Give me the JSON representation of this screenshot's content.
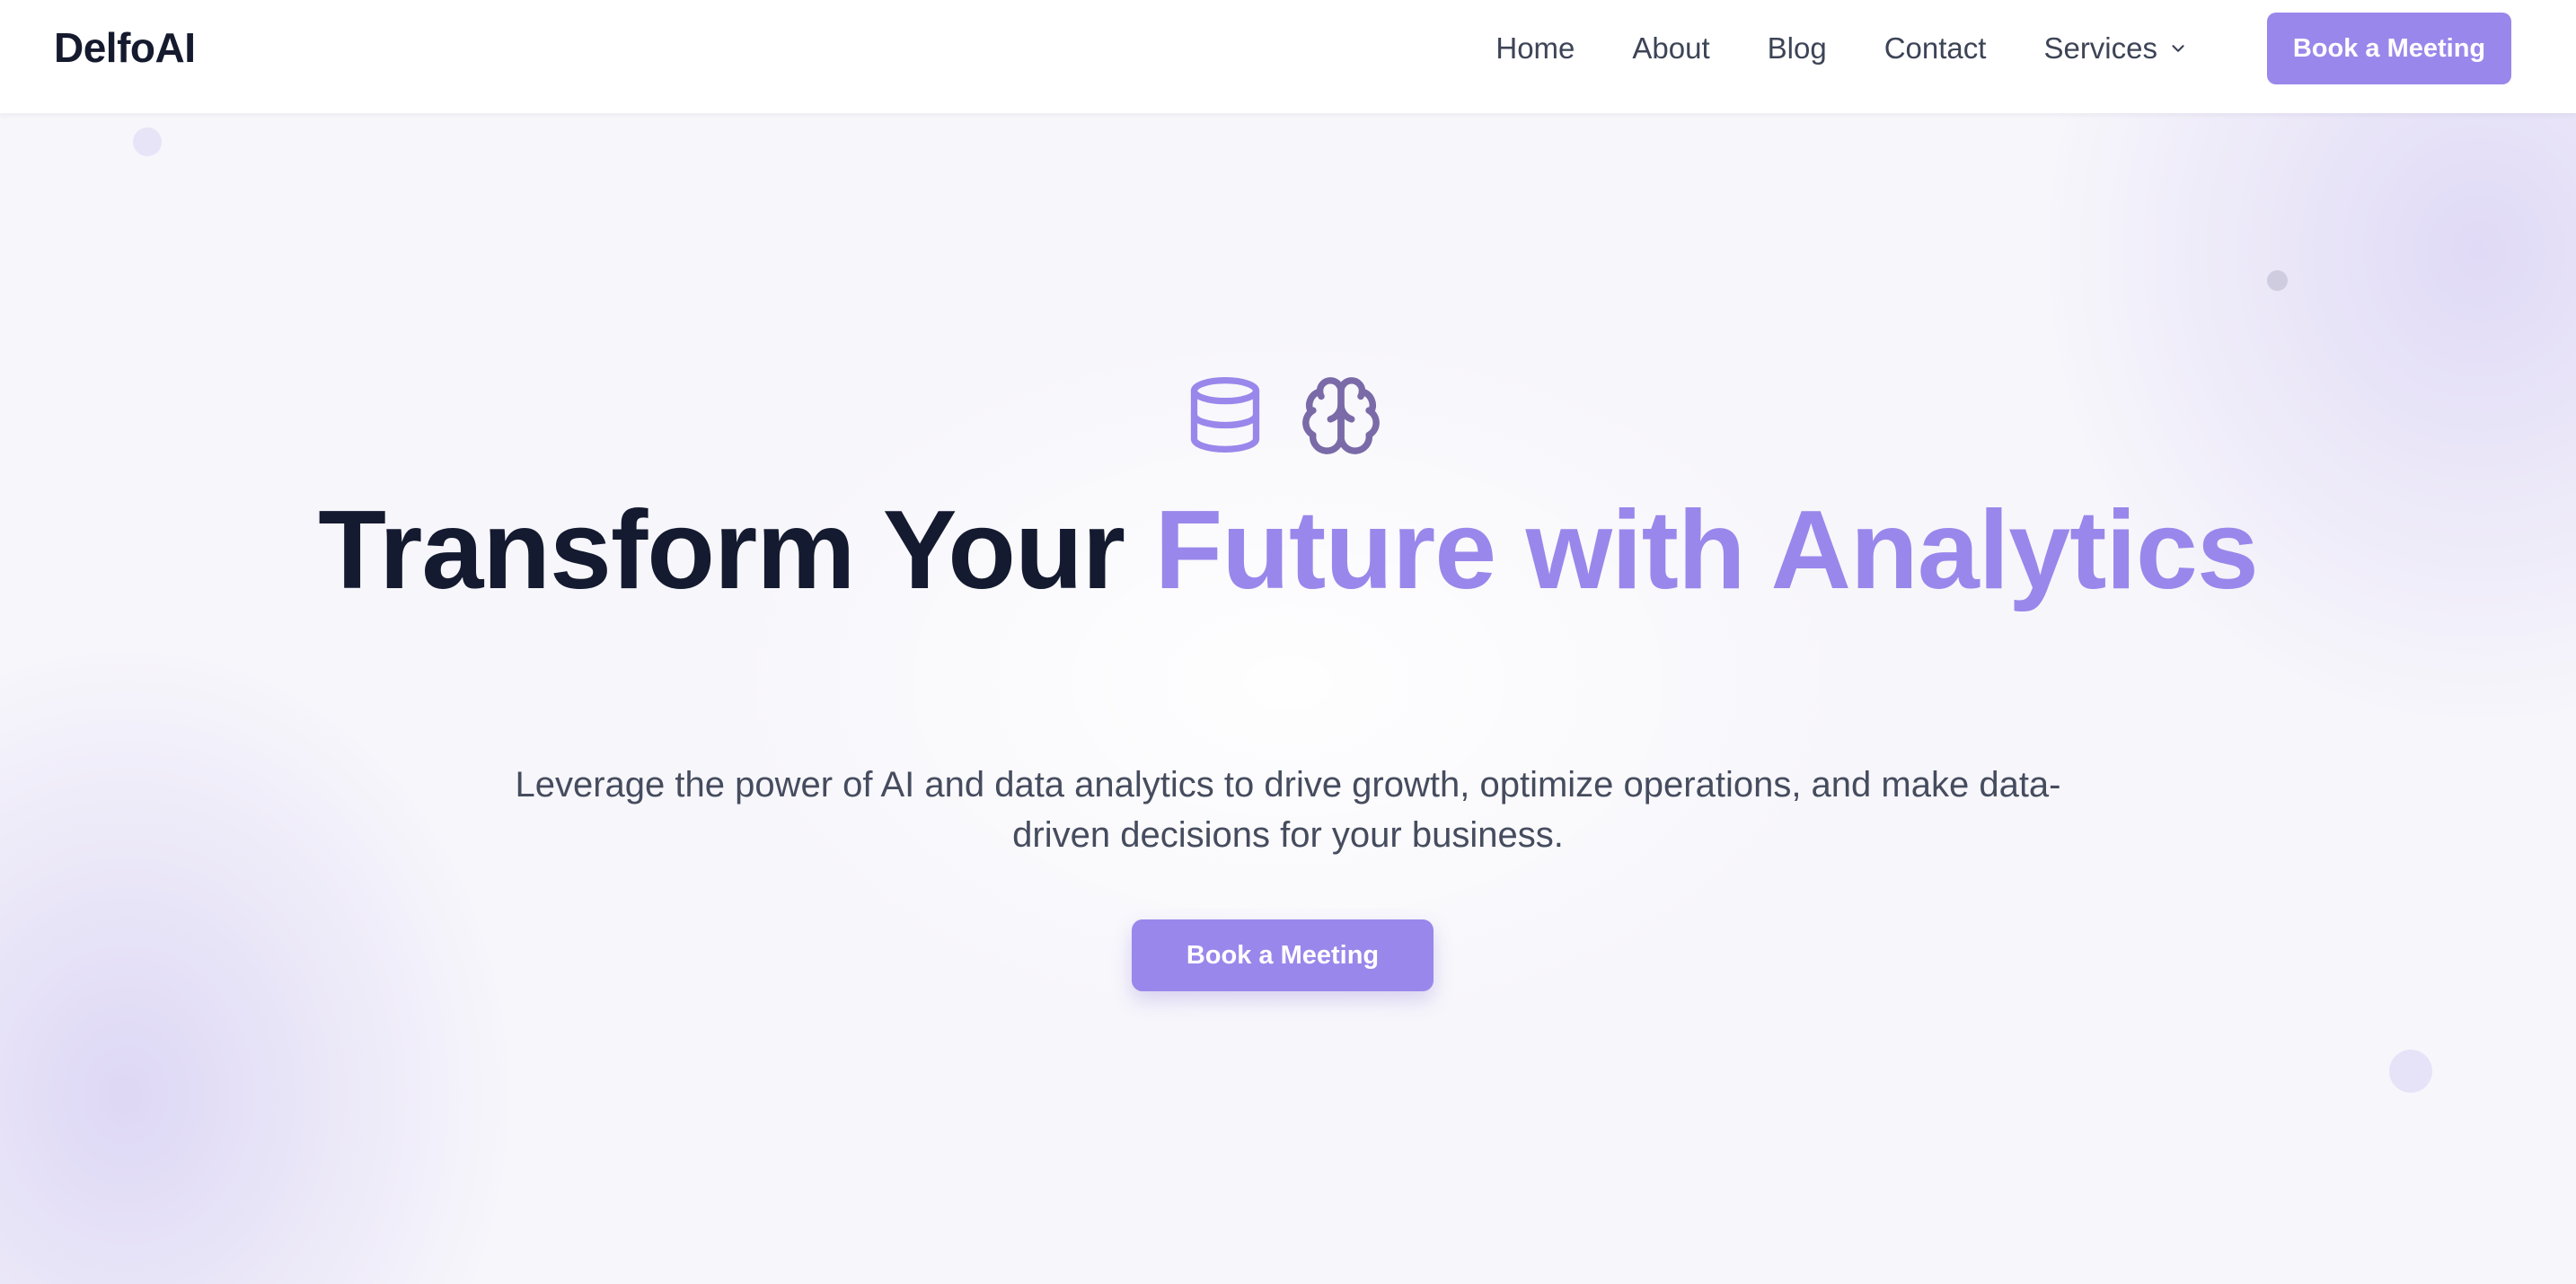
{
  "brand": {
    "name": "DelfoAI"
  },
  "nav": {
    "items": [
      {
        "label": "Home"
      },
      {
        "label": "About"
      },
      {
        "label": "Blog"
      },
      {
        "label": "Contact"
      },
      {
        "label": "Services",
        "icon": "chevron-down-icon"
      }
    ],
    "cta_label": "Book a Meeting"
  },
  "hero": {
    "icons": [
      "database-icon",
      "brain-icon"
    ],
    "title_main": "Transform Your",
    "title_accent": "Future with Analytics",
    "subtitle": "Leverage the power of AI and data analytics to drive growth, optimize operations, and make data-driven decisions for your business.",
    "cta_label": "Book a Meeting"
  },
  "colors": {
    "accent": "#9a87eb",
    "heading": "#141a2f",
    "body_text": "#454c5e",
    "brain_icon": "#7a6aa8"
  }
}
